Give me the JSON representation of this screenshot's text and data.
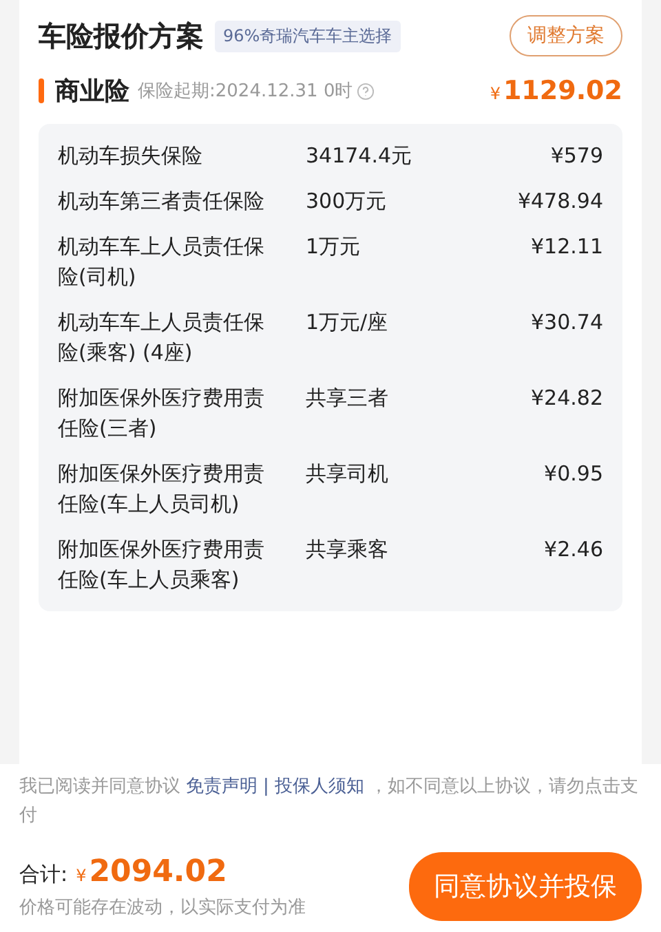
{
  "header": {
    "title": "车险报价方案",
    "badge": "96%奇瑞汽车车主选择",
    "adjust_button": "调整方案"
  },
  "section": {
    "name": "商业险",
    "start_date": "保险起期:2024.12.31 0时",
    "currency": "¥",
    "total": "1129.02"
  },
  "items": [
    {
      "name": "机动车损失保险",
      "coverage": "34174.4元",
      "price": "¥579"
    },
    {
      "name": "机动车第三者责任保险",
      "coverage": "300万元",
      "price": "¥478.94"
    },
    {
      "name": "机动车车上人员责任保险(司机)",
      "coverage": "1万元",
      "price": "¥12.11"
    },
    {
      "name": "机动车车上人员责任保险(乘客) (4座)",
      "coverage": "1万元/座",
      "price": "¥30.74"
    },
    {
      "name": "附加医保外医疗费用责任险(三者)",
      "coverage": "共享三者",
      "price": "¥24.82"
    },
    {
      "name": "附加医保外医疗费用责任险(车上人员司机)",
      "coverage": "共享司机",
      "price": "¥0.95"
    },
    {
      "name": "附加医保外医疗费用责任险(车上人员乘客)",
      "coverage": "共享乘客",
      "price": "¥2.46"
    }
  ],
  "footer": {
    "agreement_prefix": "我已阅读并同意协议",
    "links": [
      "免责声明",
      "投保人须知"
    ],
    "separator": "|",
    "agreement_suffix": "，如不同意以上协议，请勿点击支付",
    "total_label": "合计:",
    "currency": "¥",
    "total": "2094.02",
    "note": "价格可能存在波动，以实际支付为准",
    "submit_button": "同意协议并投保"
  }
}
